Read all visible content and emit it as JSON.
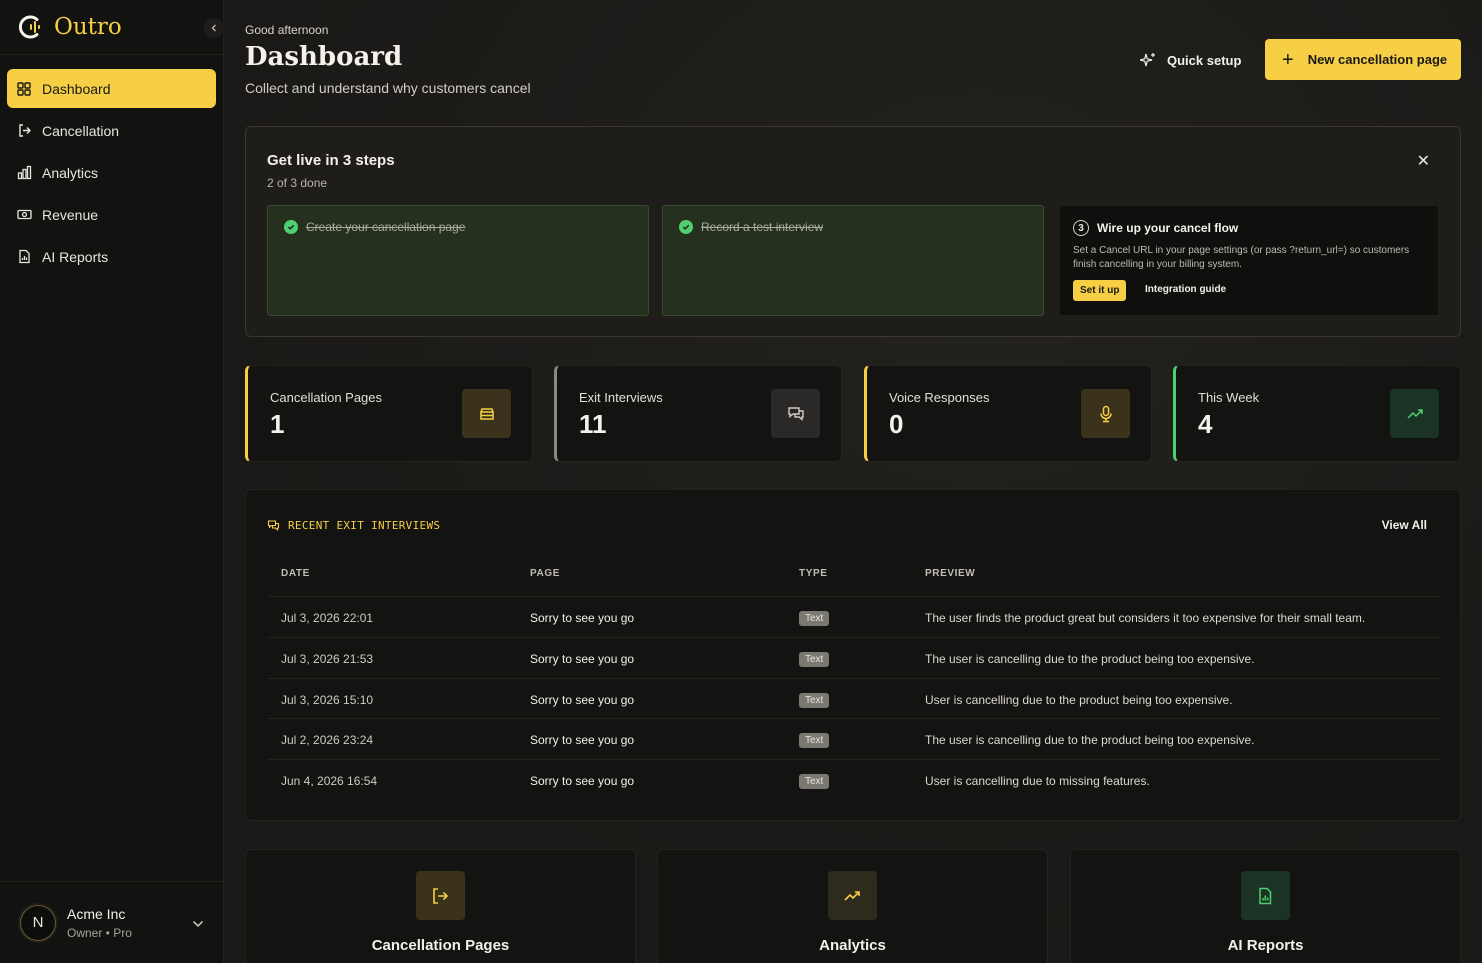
{
  "brand": {
    "name": "Outro"
  },
  "sidebar": {
    "items": [
      {
        "label": "Dashboard",
        "icon": "dashboard-grid-icon",
        "active": true
      },
      {
        "label": "Cancellation",
        "icon": "log-out-icon"
      },
      {
        "label": "Analytics",
        "icon": "bar-chart-icon"
      },
      {
        "label": "Revenue",
        "icon": "banknote-icon"
      },
      {
        "label": "AI Reports",
        "icon": "file-chart-icon"
      }
    ],
    "account": {
      "initial": "N",
      "name": "Acme Inc",
      "role": "Owner • Pro"
    }
  },
  "header": {
    "greeting": "Good afternoon",
    "title": "Dashboard",
    "subtitle": "Collect and understand why customers cancel",
    "quick_setup": "Quick setup",
    "new_page": "New cancellation page"
  },
  "onboarding": {
    "title": "Get live in 3 steps",
    "progress": "2 of 3 done",
    "steps": [
      {
        "label": "Create your cancellation page",
        "done": true
      },
      {
        "label": "Record a test interview",
        "done": true
      },
      {
        "number": "3",
        "label": "Wire up your cancel flow",
        "done": false,
        "description": "Set a Cancel URL in your page settings (or pass ?return_url=) so customers finish cancelling in your billing system.",
        "primary_action": "Set it up",
        "secondary_action": "Integration guide"
      }
    ]
  },
  "stats": [
    {
      "label": "Cancellation Pages",
      "value": "1",
      "icon": "box-icon",
      "accent": "#f7cf45"
    },
    {
      "label": "Exit Interviews",
      "value": "11",
      "icon": "chat-icon",
      "accent": "#8a8880"
    },
    {
      "label": "Voice Responses",
      "value": "0",
      "icon": "mic-icon",
      "accent": "#f7cf45"
    },
    {
      "label": "This Week",
      "value": "4",
      "icon": "trending-up-icon",
      "accent": "#4fcf72"
    }
  ],
  "recent": {
    "title": "RECENT EXIT INTERVIEWS",
    "view_all": "View All",
    "columns": [
      "DATE",
      "PAGE",
      "TYPE",
      "PREVIEW"
    ],
    "rows": [
      {
        "date": "Jul 3, 2026 22:01",
        "page": "Sorry to see you go",
        "type": "Text",
        "preview": "The user finds the product great but considers it too expensive for their small team."
      },
      {
        "date": "Jul 3, 2026 21:53",
        "page": "Sorry to see you go",
        "type": "Text",
        "preview": "The user is cancelling due to the product being too expensive."
      },
      {
        "date": "Jul 3, 2026 15:10",
        "page": "Sorry to see you go",
        "type": "Text",
        "preview": "User is cancelling due to the product being too expensive."
      },
      {
        "date": "Jul 2, 2026 23:24",
        "page": "Sorry to see you go",
        "type": "Text",
        "preview": "The user is cancelling due to the product being too expensive."
      },
      {
        "date": "Jun 4, 2026 16:54",
        "page": "Sorry to see you go",
        "type": "Text",
        "preview": "User is cancelling due to missing features."
      }
    ]
  },
  "shortcuts": [
    {
      "label": "Cancellation Pages",
      "icon": "log-out-icon"
    },
    {
      "label": "Analytics",
      "icon": "trending-up-icon"
    },
    {
      "label": "AI Reports",
      "icon": "file-chart-icon"
    }
  ],
  "colors": {
    "accent": "#f7cf45",
    "success": "#4fcf72",
    "background": "#1a1917"
  }
}
